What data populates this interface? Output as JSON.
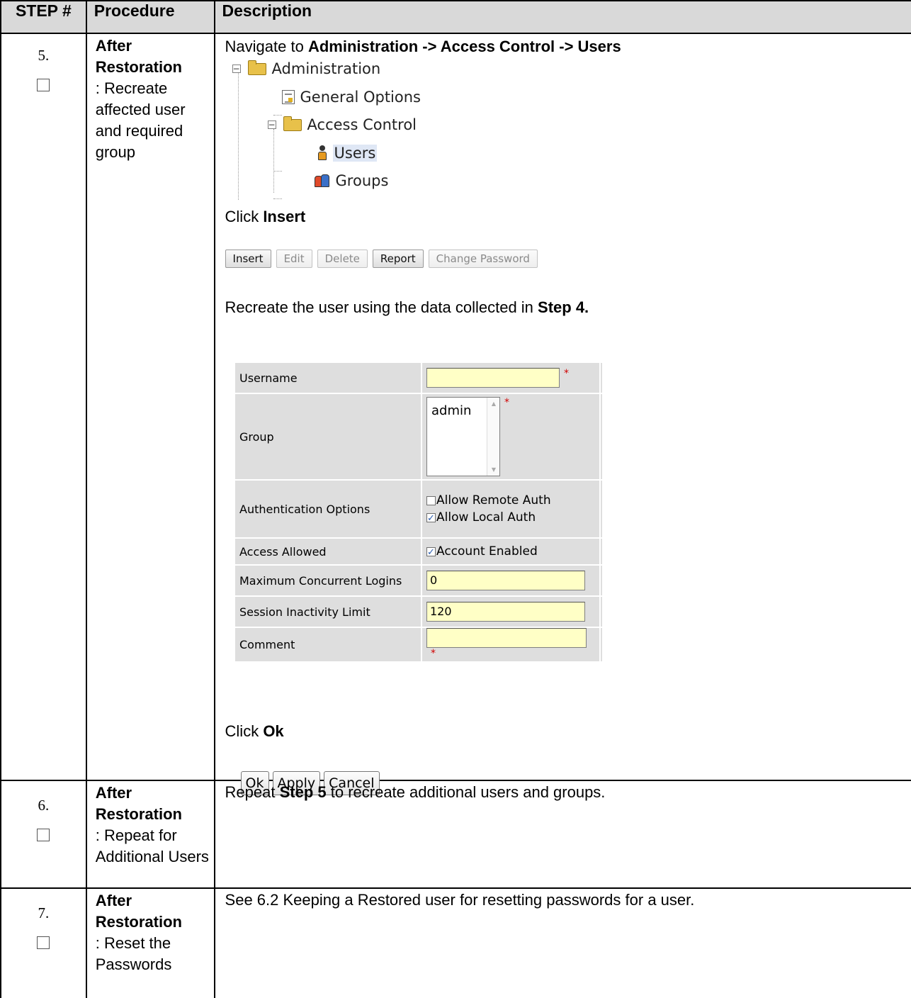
{
  "header": {
    "step": "STEP #",
    "procedure": "Procedure",
    "description": "Description"
  },
  "steps": [
    {
      "number": "5.",
      "procedure_bold": "After Restoration",
      "procedure_text": ": Recreate affected user and required group",
      "nav": {
        "prefix": "Navigate to ",
        "path": "Administration -> Access Control -> Users"
      },
      "tree": {
        "administration": "Administration",
        "general_options": "General Options",
        "access_control": "Access Control",
        "users": "Users",
        "groups": "Groups"
      },
      "click_insert": {
        "prefix": "Click ",
        "bold": "Insert"
      },
      "toolbar": {
        "insert": "Insert",
        "edit": "Edit",
        "delete": "Delete",
        "report": "Report",
        "change_password": "Change Password"
      },
      "recreate": {
        "prefix": "Recreate the user using the data collected in ",
        "bold": "Step 4."
      },
      "form": {
        "username_label": "Username",
        "username_value": "",
        "group_label": "Group",
        "group_option": "admin",
        "auth_label": "Authentication Options",
        "auth_remote": "Allow Remote Auth",
        "auth_remote_checked": false,
        "auth_local": "Allow Local Auth",
        "auth_local_checked": true,
        "access_label": "Access Allowed",
        "access_enabled": "Account Enabled",
        "access_enabled_checked": true,
        "max_logins_label": "Maximum Concurrent Logins",
        "max_logins_value": "0",
        "session_label": "Session Inactivity Limit",
        "session_value": "120",
        "comment_label": "Comment",
        "comment_value": "",
        "required_mark": "*"
      },
      "click_ok": {
        "prefix": "Click ",
        "bold": "Ok"
      },
      "dialog": {
        "ok": "Ok",
        "apply": "Apply",
        "cancel": "Cancel"
      }
    },
    {
      "number": "6.",
      "procedure_bold": "After Restoration",
      "procedure_text": ": Repeat for Additional Users",
      "desc_prefix": "Repeat ",
      "desc_bold": "Step 5",
      "desc_suffix": " to recreate additional users and groups."
    },
    {
      "number": "7.",
      "procedure_bold": "After Restoration",
      "procedure_text": ": Reset the Passwords",
      "desc_prefix": "See ",
      "desc_ref": "6.2 Keeping a Restored user",
      "desc_suffix": " for resetting passwords for a user."
    }
  ]
}
